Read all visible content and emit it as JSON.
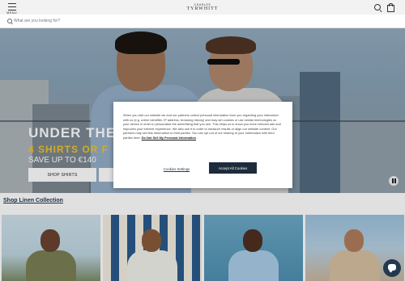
{
  "header": {
    "menu_label": "MENU",
    "logo_small": "CHARLES",
    "logo_main": "TYRWHITT"
  },
  "search": {
    "placeholder": "What are you looking for?"
  },
  "hero": {
    "headline": "UNDER THE",
    "offer": "4 SHIRTS OR F",
    "save": "SAVE UP TO €140",
    "shop_shirts_label": "SHOP SHIRTS",
    "second_button_label": ""
  },
  "section": {
    "title": "Shop Linen Collection"
  },
  "cookie_banner": {
    "text": "When you visit our website we and our partners collect personal information from you regarding your interaction with us (e.g. online identifier, IP address, browsing history) and may set cookies or use similar technologies on your device in order to personalize the advertising that you see. This helps us to show you more relevant ads and improves your internet experience. We also use it in order to measure results or align our website content. Our partners may sell this information to third parties. You can opt out of our sharing of your information with third parties here:",
    "link_label": "Do Not Sell My Personal Information",
    "settings_label": "Cookies Settings",
    "accept_label": "Accept All Cookies"
  },
  "colors": {
    "brand_navy": "#1c2c3c",
    "offer_yellow": "#f0c430",
    "link_blue": "#23394f"
  }
}
